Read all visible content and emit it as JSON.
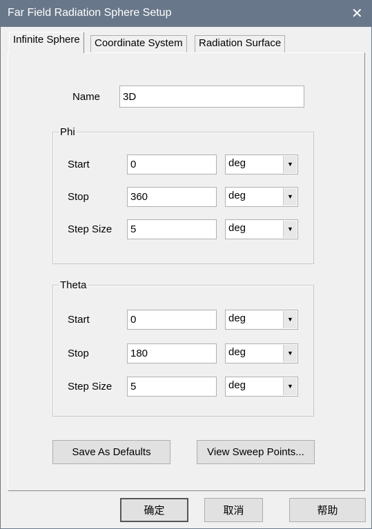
{
  "window": {
    "title": "Far Field Radiation Sphere Setup",
    "close_icon": "close-icon"
  },
  "tabs": [
    {
      "label": "Infinite Sphere",
      "active": true
    },
    {
      "label": "Coordinate System"
    },
    {
      "label": "Radiation Surface"
    }
  ],
  "name": {
    "label": "Name",
    "value": "3D"
  },
  "phi": {
    "title": "Phi",
    "start": {
      "label": "Start",
      "value": "0",
      "unit": "deg"
    },
    "stop": {
      "label": "Stop",
      "value": "360",
      "unit": "deg"
    },
    "step": {
      "label": "Step Size",
      "value": "5",
      "unit": "deg"
    }
  },
  "theta": {
    "title": "Theta",
    "start": {
      "label": "Start",
      "value": "0",
      "unit": "deg"
    },
    "stop": {
      "label": "Stop",
      "value": "180",
      "unit": "deg"
    },
    "step": {
      "label": "Step Size",
      "value": "5",
      "unit": "deg"
    }
  },
  "buttons": {
    "save_defaults": "Save As Defaults",
    "view_sweep": "View Sweep Points...",
    "ok": "确定",
    "cancel": "取消",
    "help": "帮助"
  }
}
